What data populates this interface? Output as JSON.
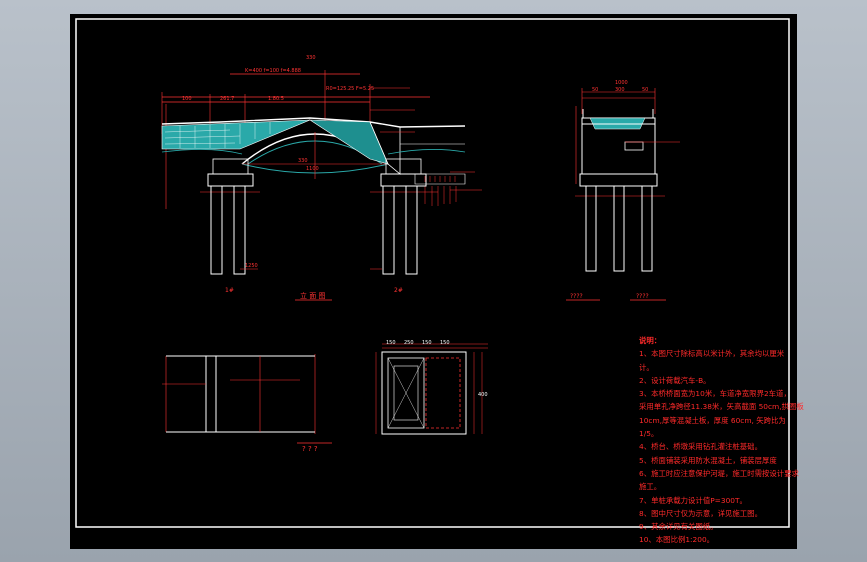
{
  "drawing": {
    "view_labels": {
      "elevation": "立 面 图",
      "plan": "? ? ?",
      "side_left": "????",
      "side_right": "????"
    },
    "pier_labels": {
      "left": "1#",
      "right": "2#"
    },
    "dimensions": {
      "top_total": "330",
      "top_segments": [
        "100",
        "261.7",
        "1.80.5"
      ],
      "arch_formula_1": "K=400  f=100  f=4.888",
      "arch_formula_2": "R0=125.25 F=5.25",
      "span_label": "330",
      "span_inner": "1100",
      "side_top": "1000",
      "side_segments": [
        "50",
        "300",
        "50"
      ],
      "plan_widths": [
        "150",
        "250",
        "150",
        "150"
      ],
      "plan_right": "400",
      "pile_label": "1250"
    }
  },
  "notes": {
    "title": "说明：",
    "lines": [
      "1、本图尺寸除标高以米计外，其余均以厘米",
      "计。",
      "2、设计荷载汽车-B。",
      "3、本桥桥面宽为10米，车道净宽限界2车道，",
      "采用单孔净跨径11.38米，矢高截面 50cm,拱圈板",
      "10cm,厚等混凝土板，厚度 60cm, 矢跨比为",
      "1/5。",
      "4、桥台、桥墩采用钻孔灌注桩基础。",
      "5、桥面铺装采用防水混凝土，铺装层厚度",
      "6、施工时应注意保护河堤，施工时需按设计要求",
      "施工。",
      "7、单桩承载力设计值P=300T。",
      "8、图中尺寸仅为示意，详见施工图。",
      "9、其余详见有关图纸。",
      "10、本图比例1:200。"
    ]
  }
}
